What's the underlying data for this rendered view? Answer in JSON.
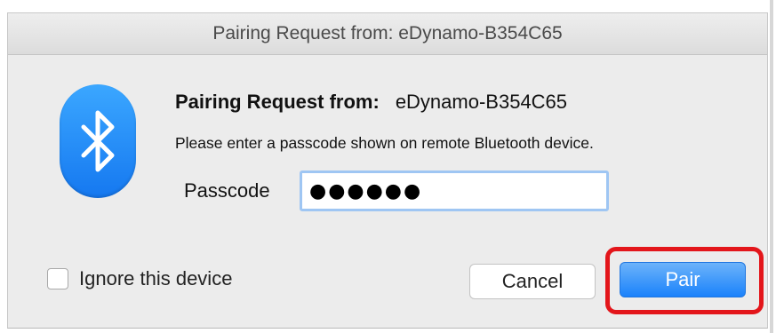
{
  "window": {
    "title": "Pairing Request from: eDynamo-B354C65"
  },
  "dialog": {
    "heading_label": "Pairing Request from:",
    "device_name": "eDynamo-B354C65",
    "instruction": "Please enter a passcode shown on remote Bluetooth device.",
    "passcode_label": "Passcode",
    "passcode_value": "●●●●●●"
  },
  "options": {
    "ignore_label": "Ignore this device",
    "ignore_checked": false
  },
  "buttons": {
    "cancel_label": "Cancel",
    "pair_label": "Pair"
  },
  "icons": {
    "app_icon": "bluetooth-icon"
  },
  "colors": {
    "accent_blue": "#1a82fb",
    "highlight_red": "#e3161b"
  }
}
